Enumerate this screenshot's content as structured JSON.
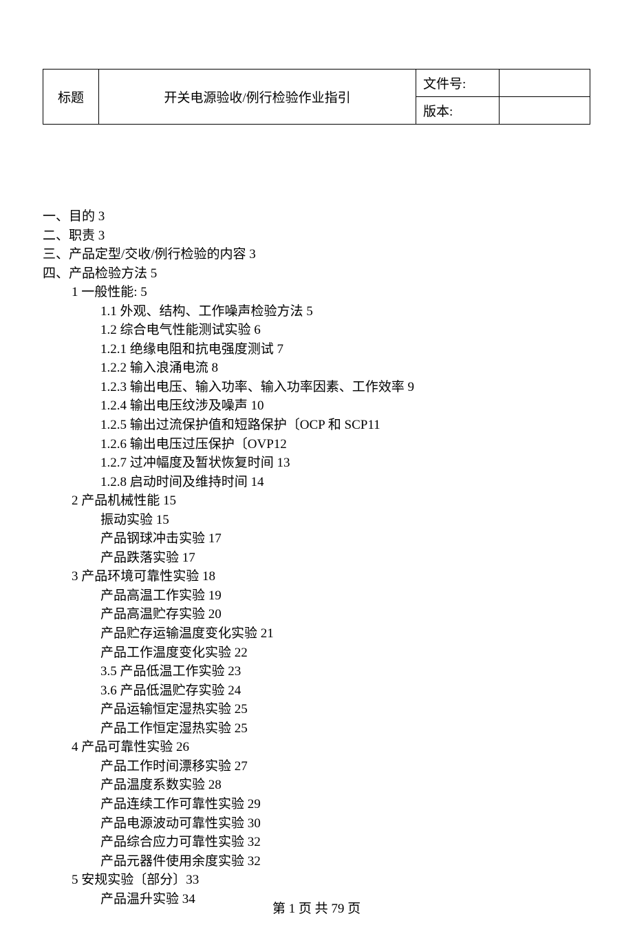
{
  "header": {
    "title_label": "标题",
    "doc_title": "开关电源验收/例行检验作业指引",
    "doc_no_label": "文件号:",
    "doc_no_value": "",
    "version_label": "版本:",
    "version_value": ""
  },
  "toc": {
    "items": [
      {
        "level": 0,
        "text": "一、目的 3"
      },
      {
        "level": 0,
        "text": "二、职责 3"
      },
      {
        "level": 0,
        "text": "三、产品定型/交收/例行检验的内容 3"
      },
      {
        "level": 0,
        "text": "四、产品检验方法 5"
      },
      {
        "level": 1,
        "text": "1 一般性能: 5"
      },
      {
        "level": 2,
        "text": "1.1  外观、结构、工作噪声检验方法 5"
      },
      {
        "level": 2,
        "text": "1.2  综合电气性能测试实验 6"
      },
      {
        "level": 2,
        "text": "1.2.1  绝缘电阻和抗电强度测试 7"
      },
      {
        "level": 2,
        "text": "1.2.2  输入浪涌电流 8"
      },
      {
        "level": 2,
        "text": "1.2.3  输出电压、输入功率、输入功率因素、工作效率 9"
      },
      {
        "level": 2,
        "text": "1.2.4  输出电压纹涉及噪声 10"
      },
      {
        "level": 2,
        "text": "1.2.5  输出过流保护值和短路保护〔OCP 和 SCP11"
      },
      {
        "level": 2,
        "text": "1.2.6  输出电压过压保护〔OVP12"
      },
      {
        "level": 2,
        "text": "1.2.7  过冲幅度及暂状恢复时间 13"
      },
      {
        "level": 2,
        "text": "1.2.8  启动时间及维持时间 14"
      },
      {
        "level": 1,
        "text": "2 产品机械性能 15"
      },
      {
        "level": 2,
        "text": "振动实验 15"
      },
      {
        "level": 2,
        "text": "产品钢球冲击实验 17"
      },
      {
        "level": 2,
        "text": "产品跌落实验 17"
      },
      {
        "level": 1,
        "text": "3 产品环境可靠性实验 18"
      },
      {
        "level": 2,
        "text": "产品高温工作实验 19"
      },
      {
        "level": 2,
        "text": "产品高温贮存实验 20"
      },
      {
        "level": 2,
        "text": "产品贮存运输温度变化实验 21"
      },
      {
        "level": 2,
        "text": "产品工作温度变化实验 22"
      },
      {
        "level": 2,
        "text": "3.5  产品低温工作实验 23"
      },
      {
        "level": 2,
        "text": "3.6  产品低温贮存实验 24"
      },
      {
        "level": 2,
        "text": "产品运输恒定湿热实验 25"
      },
      {
        "level": 2,
        "text": "产品工作恒定湿热实验 25"
      },
      {
        "level": 1,
        "text": "4 产品可靠性实验 26"
      },
      {
        "level": 2,
        "text": "产品工作时间漂移实验 27"
      },
      {
        "level": 2,
        "text": "产品温度系数实验 28"
      },
      {
        "level": 2,
        "text": "产品连续工作可靠性实验 29"
      },
      {
        "level": 2,
        "text": "产品电源波动可靠性实验 30"
      },
      {
        "level": 2,
        "text": "产品综合应力可靠性实验 32"
      },
      {
        "level": 2,
        "text": "产品元器件使用余度实验 32"
      },
      {
        "level": 1,
        "text": "5 安规实验〔部分〕33"
      },
      {
        "level": 2,
        "text": "产品温升实验 34"
      }
    ]
  },
  "footer": {
    "text": "第 1 页 共 79 页"
  }
}
